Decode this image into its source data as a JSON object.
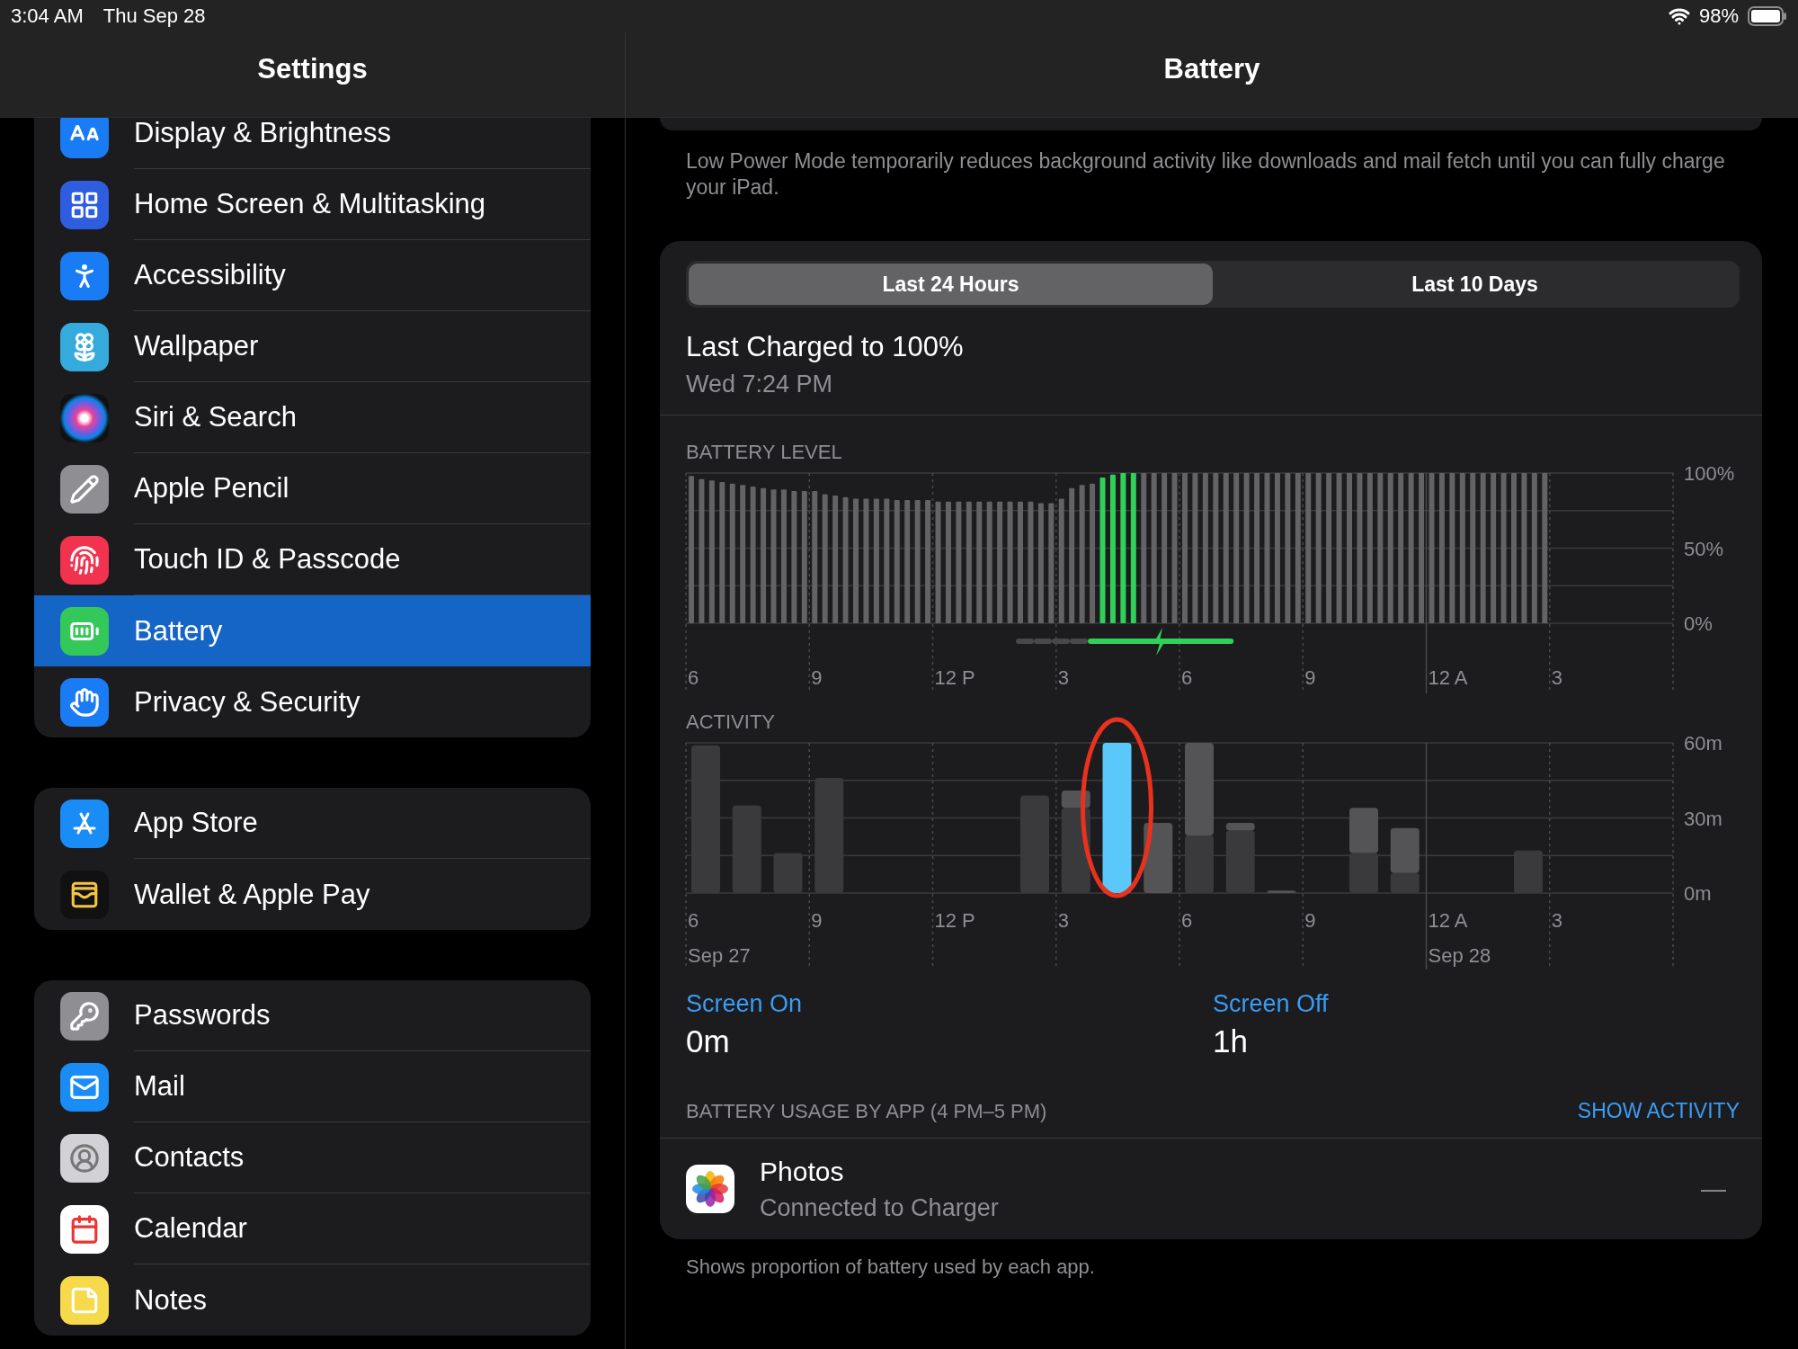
{
  "status_bar": {
    "time": "3:04 AM",
    "date": "Thu Sep 28",
    "battery": "98%"
  },
  "sidebar": {
    "title": "Settings",
    "groups": [
      {
        "items": [
          {
            "label": "Display & Brightness",
            "selected": false
          },
          {
            "label": "Home Screen & Multitasking",
            "selected": false
          },
          {
            "label": "Accessibility",
            "selected": false
          },
          {
            "label": "Wallpaper",
            "selected": false
          },
          {
            "label": "Siri & Search",
            "selected": false
          },
          {
            "label": "Apple Pencil",
            "selected": false
          },
          {
            "label": "Touch ID & Passcode",
            "selected": false
          },
          {
            "label": "Battery",
            "selected": true
          },
          {
            "label": "Privacy & Security",
            "selected": false
          }
        ]
      },
      {
        "items": [
          {
            "label": "App Store",
            "selected": false
          },
          {
            "label": "Wallet & Apple Pay",
            "selected": false
          }
        ]
      },
      {
        "items": [
          {
            "label": "Passwords",
            "selected": false
          },
          {
            "label": "Mail",
            "selected": false
          },
          {
            "label": "Contacts",
            "selected": false
          },
          {
            "label": "Calendar",
            "selected": false
          },
          {
            "label": "Notes",
            "selected": false
          }
        ]
      }
    ]
  },
  "detail": {
    "title": "Battery",
    "low_power_note": "Low Power Mode temporarily reduces background activity like downloads and mail fetch until you can fully charge your iPad.",
    "segments": [
      {
        "label": "Last 24 Hours",
        "selected": true
      },
      {
        "label": "Last 10 Days",
        "selected": false
      }
    ],
    "last_charged": {
      "title": "Last Charged to 100%",
      "time": "Wed 7:24 PM"
    },
    "battery_level": {
      "label": "BATTERY LEVEL",
      "x_axis_labels": [
        "6",
        "9",
        "12 P",
        "3",
        "6",
        "9",
        "12 A",
        "3"
      ],
      "chart_data": {
        "type": "bar",
        "stacked": true,
        "grid": true,
        "ylim": [
          0,
          100
        ],
        "series": [
          {
            "color": "#636366",
            "values": [
              98,
              96,
              95,
              94,
              93,
              92,
              91,
              90,
              89,
              89,
              88,
              88,
              88,
              86,
              85,
              84,
              83,
              83,
              83,
              83,
              82,
              82,
              82,
              82,
              81,
              81,
              81,
              81,
              81,
              81,
              81,
              81,
              81,
              81,
              80,
              80,
              83,
              90,
              92,
              93,
              null,
              null,
              null,
              null,
              100,
              100,
              100,
              100,
              100,
              100,
              100,
              100,
              100,
              100,
              100,
              100,
              100,
              100,
              100,
              100,
              100,
              100,
              100,
              100,
              100,
              100,
              100,
              100,
              100,
              100,
              100,
              100,
              100,
              100,
              100,
              100,
              100,
              100,
              100,
              100,
              100,
              100,
              100,
              100,
              null,
              null,
              null,
              null,
              null,
              null,
              null,
              null,
              null,
              null,
              null,
              null
            ]
          },
          {
            "color": "#30d158",
            "values": [
              null,
              null,
              null,
              null,
              null,
              null,
              null,
              null,
              null,
              null,
              null,
              null,
              null,
              null,
              null,
              null,
              null,
              null,
              null,
              null,
              null,
              null,
              null,
              null,
              null,
              null,
              null,
              null,
              null,
              null,
              null,
              null,
              null,
              null,
              null,
              null,
              null,
              null,
              null,
              null,
              97,
              99,
              100,
              100,
              null,
              null,
              null,
              null,
              null,
              null,
              null,
              null,
              null,
              null,
              null,
              null,
              null,
              null,
              null,
              null,
              null,
              null,
              null,
              null,
              null,
              null,
              null,
              null,
              null,
              null,
              null,
              null,
              null,
              null,
              null,
              null,
              null,
              null,
              null,
              null,
              null,
              null,
              null,
              null,
              null,
              null,
              null,
              null,
              null,
              null,
              null,
              null,
              null,
              null,
              null,
              null
            ]
          }
        ],
        "yticks": [
          {
            "value": 0,
            "label": "0%"
          },
          {
            "value": 50,
            "label": "50%"
          },
          {
            "value": 100,
            "label": "100%"
          }
        ]
      }
    },
    "activity": {
      "label": "ACTIVITY",
      "x_axis_labels": [
        "6",
        "9",
        "12 P",
        "3",
        "6",
        "9",
        "12 A",
        "3"
      ],
      "date_labels": [
        "Sep 27",
        "Sep 28"
      ],
      "chart_data": {
        "type": "bar",
        "stacked": true,
        "grid": true,
        "ylim": [
          0,
          60
        ],
        "series": [
          {
            "color": "#3a3a3c",
            "values": [
              59,
              35,
              16,
              46,
              0,
              0,
              0,
              0,
              39,
              34,
              0,
              0,
              23,
              25,
              0,
              0,
              16,
              8,
              0,
              0,
              17,
              0,
              0,
              0
            ]
          },
          {
            "color": "#545456",
            "values": [
              0,
              0,
              0,
              0,
              0,
              0,
              0,
              0,
              0,
              7,
              0,
              28,
              37,
              3,
              1,
              0,
              18,
              18,
              0,
              0,
              0,
              0,
              0,
              0
            ]
          },
          {
            "color": "#5ac8fa",
            "values": [
              0,
              0,
              0,
              0,
              0,
              0,
              0,
              0,
              0,
              0,
              60,
              0,
              0,
              0,
              0,
              0,
              0,
              0,
              0,
              0,
              0,
              0,
              0,
              0
            ]
          }
        ],
        "yticks": [
          {
            "value": 0,
            "label": "0m"
          },
          {
            "value": 30,
            "label": "30m"
          },
          {
            "value": 60,
            "label": "60m"
          }
        ]
      }
    },
    "screen_stats": [
      {
        "label": "Screen On",
        "value": "0m"
      },
      {
        "label": "Screen Off",
        "value": "1h"
      }
    ],
    "usage": {
      "heading": "BATTERY USAGE BY APP (4 PM–5 PM)",
      "action": "SHOW ACTIVITY",
      "apps": [
        {
          "name": "Photos",
          "detail": "Connected to Charger",
          "usage": "—"
        }
      ]
    },
    "footer": "Shows proportion of battery used by each app."
  }
}
